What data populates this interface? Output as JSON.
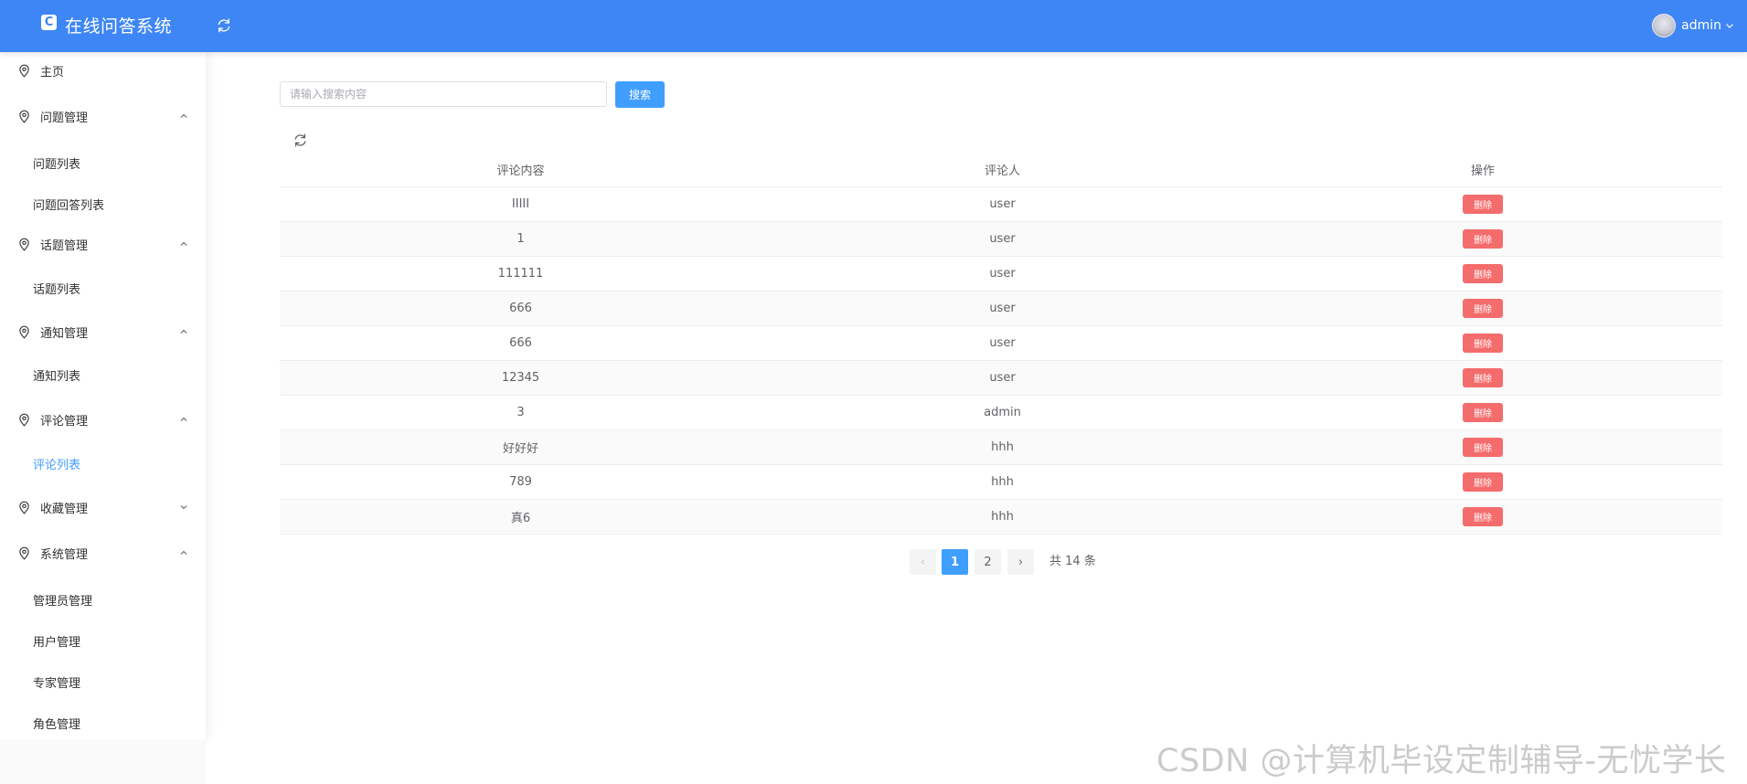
{
  "header": {
    "logo_glyph": "C",
    "app_title": "在线问答系统",
    "user_name": "admin",
    "colors": {
      "bar": "#3e86f5"
    }
  },
  "sidebar": {
    "home": "主页",
    "groups": [
      {
        "label": "问题管理",
        "expanded": true,
        "items": [
          "问题列表",
          "问题回答列表"
        ]
      },
      {
        "label": "话题管理",
        "expanded": true,
        "items": [
          "话题列表"
        ]
      },
      {
        "label": "通知管理",
        "expanded": true,
        "items": [
          "通知列表"
        ]
      },
      {
        "label": "评论管理",
        "expanded": true,
        "items": [
          "评论列表"
        ]
      },
      {
        "label": "收藏管理",
        "expanded": false,
        "items": []
      },
      {
        "label": "系统管理",
        "expanded": true,
        "items": [
          "管理员管理",
          "用户管理",
          "专家管理",
          "角色管理"
        ]
      }
    ],
    "active_item": "评论列表",
    "icons": {
      "group": "map-pin-icon",
      "chevron": "chevron-icon"
    }
  },
  "search": {
    "placeholder": "请输入搜索内容",
    "value": "",
    "button_label": "搜索"
  },
  "table": {
    "columns": [
      "评论内容",
      "评论人",
      "操作"
    ],
    "rows": [
      {
        "content": "IIIII",
        "author": "user",
        "action": "删除"
      },
      {
        "content": "1",
        "author": "user",
        "action": "删除"
      },
      {
        "content": "111111",
        "author": "user",
        "action": "删除"
      },
      {
        "content": "666",
        "author": "user",
        "action": "删除"
      },
      {
        "content": "666",
        "author": "user",
        "action": "删除"
      },
      {
        "content": "12345",
        "author": "user",
        "action": "删除"
      },
      {
        "content": "3",
        "author": "admin",
        "action": "删除"
      },
      {
        "content": "好好好",
        "author": "hhh",
        "action": "删除"
      },
      {
        "content": "789",
        "author": "hhh",
        "action": "删除"
      },
      {
        "content": "真6",
        "author": "hhh",
        "action": "删除"
      }
    ],
    "colors": {
      "delete": "#f56c6c"
    }
  },
  "pagination": {
    "prev": "‹",
    "next": "›",
    "pages": [
      "1",
      "2"
    ],
    "current": "1",
    "total_text": "共 14 条"
  },
  "watermark": "CSDN @计算机毕设定制辅导-无忧学长"
}
